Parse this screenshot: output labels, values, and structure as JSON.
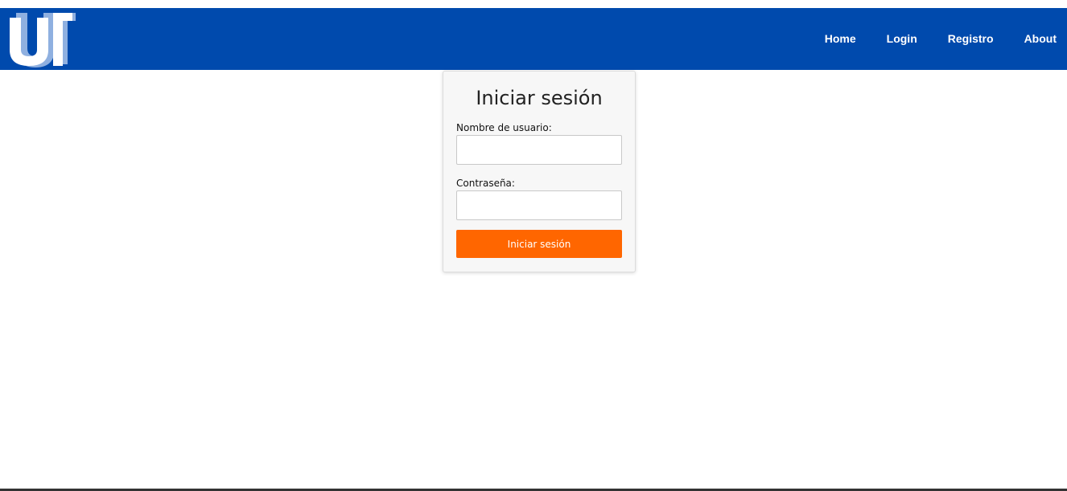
{
  "brand": {
    "logo_icon": "ui-logo-icon",
    "primary_color": "#004aad",
    "accent_color": "#ff6600"
  },
  "nav": {
    "items": [
      {
        "label": "Home"
      },
      {
        "label": "Login"
      },
      {
        "label": "Registro"
      },
      {
        "label": "About"
      }
    ]
  },
  "login": {
    "title": "Iniciar sesión",
    "username_label": "Nombre de usuario:",
    "username_value": "",
    "password_label": "Contraseña:",
    "password_value": "",
    "submit_label": "Iniciar sesión"
  }
}
